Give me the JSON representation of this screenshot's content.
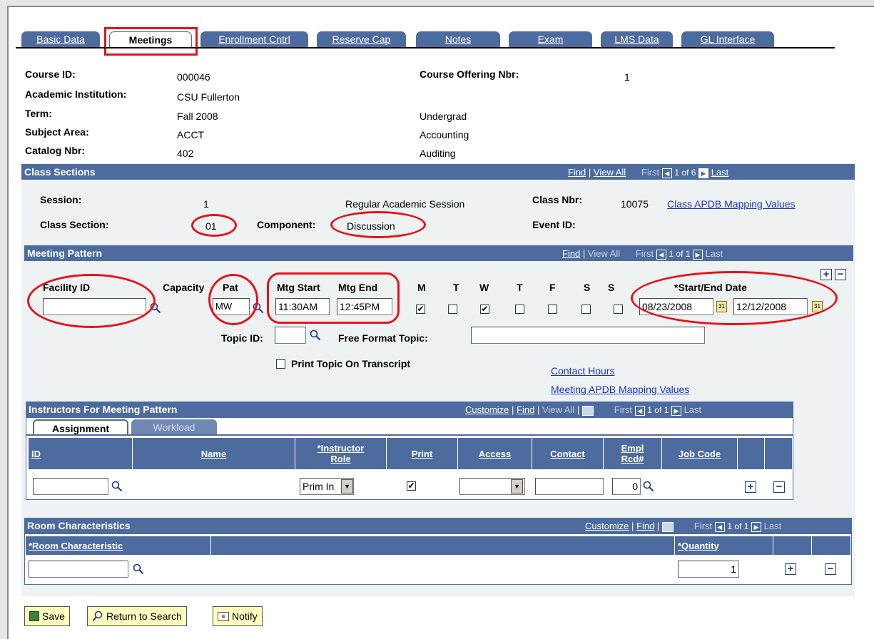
{
  "tabs": [
    {
      "label": "Basic Data"
    },
    {
      "label": "Meetings"
    },
    {
      "label": "Enrollment Cntrl"
    },
    {
      "label": "Reserve Cap"
    },
    {
      "label": "Notes"
    },
    {
      "label": "Exam"
    },
    {
      "label": "LMS Data"
    },
    {
      "label": "GL Interface"
    }
  ],
  "header": {
    "course_id_label": "Course ID:",
    "course_id": "000046",
    "institution_label": "Academic Institution:",
    "institution": "CSU Fullerton",
    "term_label": "Term:",
    "term": "Fall 2008",
    "term_desc": "Undergrad",
    "subject_label": "Subject Area:",
    "subject": "ACCT",
    "subject_desc": "Accounting",
    "catalog_label": "Catalog Nbr:",
    "catalog": "402",
    "catalog_desc": "Auditing",
    "offering_label": "Course Offering Nbr:",
    "offering": "1"
  },
  "class_sections": {
    "title": "Class Sections",
    "find": "Find",
    "view_all": "View All",
    "first": "First",
    "count": "1 of 6",
    "last": "Last",
    "session_label": "Session:",
    "session": "1",
    "session_desc": "Regular Academic Session",
    "class_nbr_label": "Class Nbr:",
    "class_nbr": "10075",
    "apdb_link": "Class APDB Mapping Values",
    "section_label": "Class Section:",
    "section": "01",
    "component_label": "Component:",
    "component": "Discussion",
    "event_label": "Event ID:"
  },
  "meeting_pattern": {
    "title": "Meeting Pattern",
    "find": "Find",
    "view_all": "View All",
    "first": "First",
    "count": "1 of 1",
    "last": "Last",
    "facility_label": "Facility ID",
    "facility": "",
    "capacity_label": "Capacity",
    "pat_label": "Pat",
    "pat": "MW",
    "mtg_start_label": "Mtg Start",
    "mtg_start": "11:30AM",
    "mtg_end_label": "Mtg End",
    "mtg_end": "12:45PM",
    "days": [
      {
        "label": "M",
        "checked": "✔"
      },
      {
        "label": "T",
        "checked": ""
      },
      {
        "label": "W",
        "checked": "✔"
      },
      {
        "label": "T",
        "checked": ""
      },
      {
        "label": "F",
        "checked": ""
      },
      {
        "label": "S",
        "checked": ""
      },
      {
        "label": "S",
        "checked": ""
      }
    ],
    "date_label": "*Start/End Date",
    "start_date": "08/23/2008",
    "end_date": "12/12/2008",
    "topic_label": "Topic ID:",
    "free_format_label": "Free Format Topic:",
    "print_topic_label": "Print Topic On Transcript",
    "contact_hours": "Contact Hours",
    "meeting_apdb": "Meeting APDB Mapping Values"
  },
  "instructors": {
    "title": "Instructors For Meeting Pattern",
    "customize": "Customize",
    "find": "Find",
    "view_all": "View All",
    "first": "First",
    "count": "1 of 1",
    "last": "Last",
    "subtab_assignment": "Assignment",
    "subtab_workload": "Workload",
    "col_id": "ID",
    "col_name": "Name",
    "col_role_1": "*Instructor",
    "col_role_2": "Role",
    "col_print": "Print",
    "col_access": "Access",
    "col_contact": "Contact",
    "col_empl_1": "Empl",
    "col_empl_2": "Rcd#",
    "col_job": "Job Code",
    "role_value": "Prim In",
    "print_checked": "✔",
    "empl_rcd": "0"
  },
  "room": {
    "title": "Room Characteristics",
    "customize": "Customize",
    "find": "Find",
    "first": "First",
    "count": "1 of 1",
    "last": "Last",
    "col_char": "*Room Characteristic",
    "col_qty": "*Quantity",
    "quantity": "1"
  },
  "buttons": {
    "save": "Save",
    "return": "Return to Search",
    "notify": "Notify"
  },
  "colors": {
    "header_bar": "#4d6b9e",
    "annotation": "#e3141c",
    "panel": "#eff2f2",
    "link": "#1a33c8"
  }
}
